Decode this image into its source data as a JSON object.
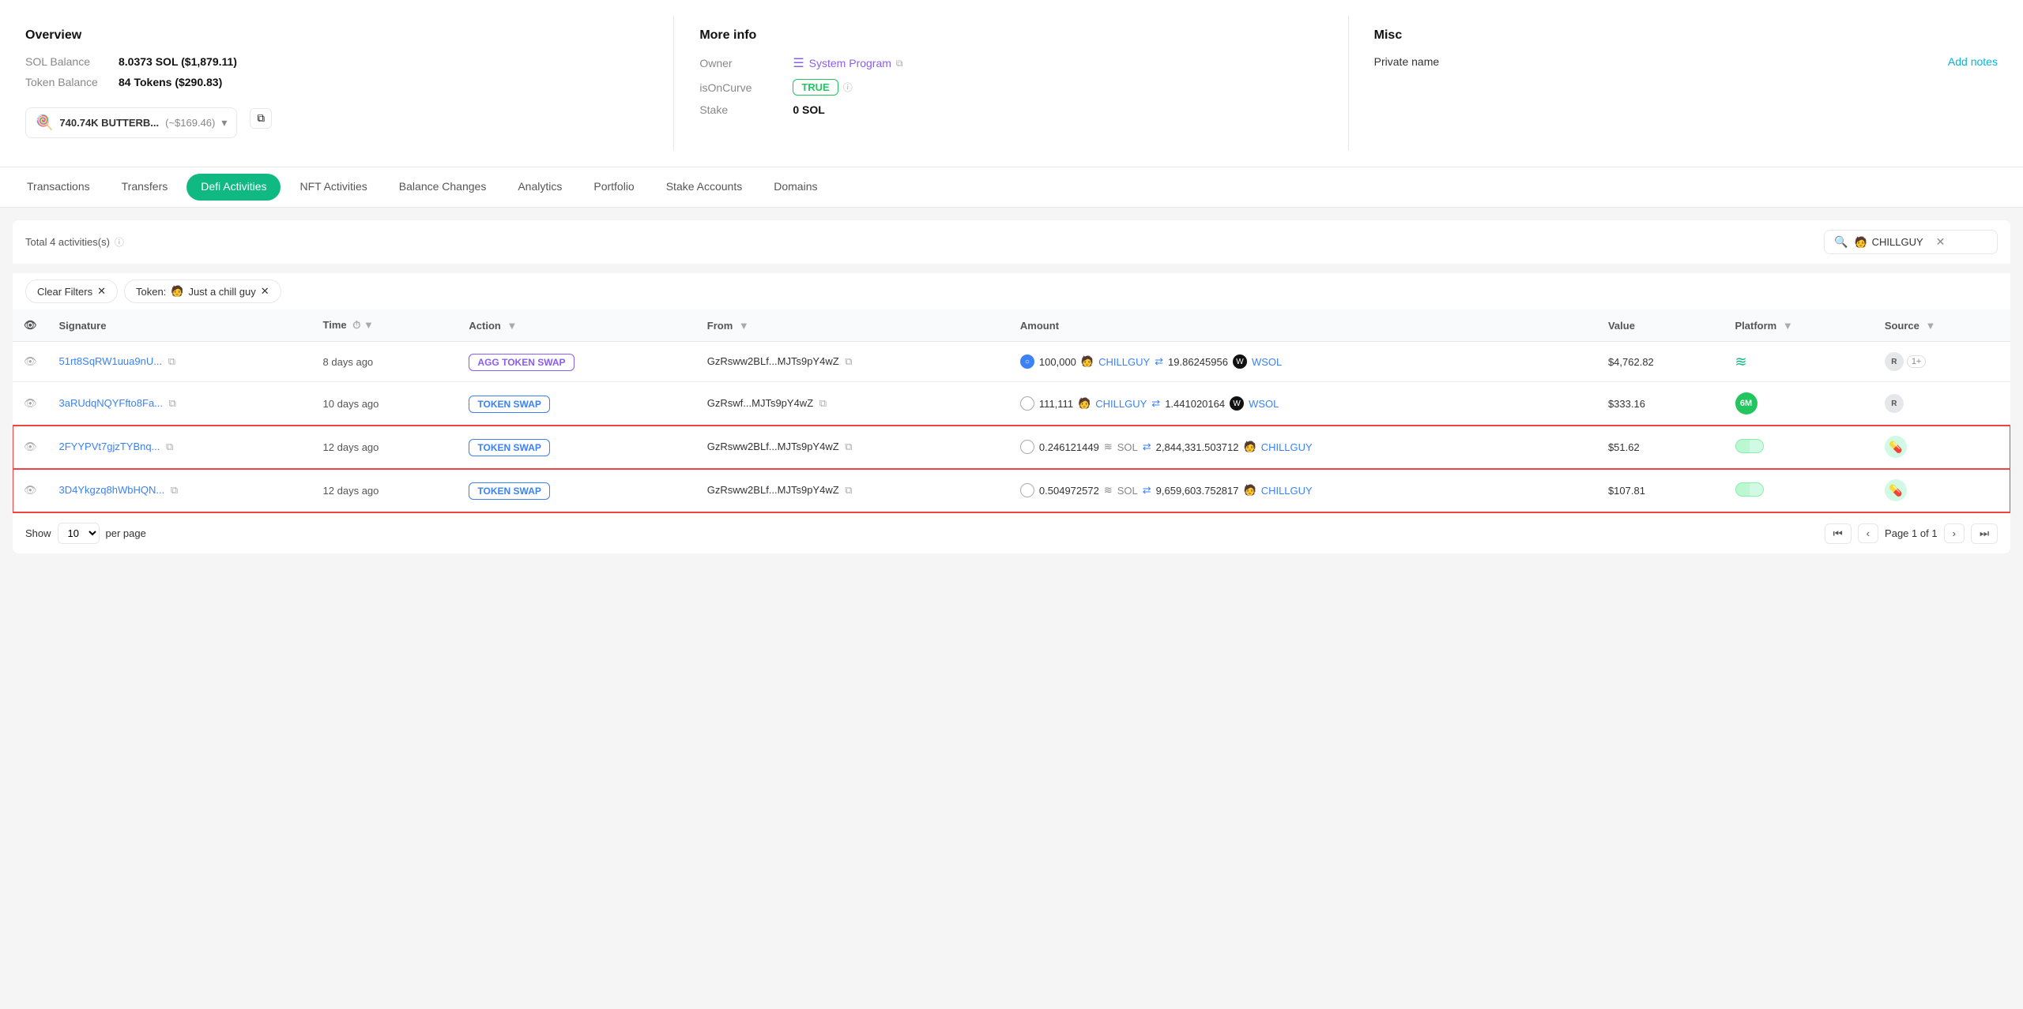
{
  "overview": {
    "title": "Overview",
    "sol_balance_label": "SOL Balance",
    "sol_balance_value": "8.0373 SOL ($1,879.11)",
    "token_balance_label": "Token Balance",
    "token_balance_value": "84 Tokens ($290.83)",
    "selected_token_emoji": "🍭",
    "selected_token_name": "740.74K BUTTERB...",
    "selected_token_usd": "(~$169.46)"
  },
  "more_info": {
    "title": "More info",
    "owner_label": "Owner",
    "owner_value": "System Program",
    "isoncurve_label": "isOnCurve",
    "isoncurve_value": "TRUE",
    "stake_label": "Stake",
    "stake_value": "0 SOL"
  },
  "misc": {
    "title": "Misc",
    "private_name_label": "Private name",
    "add_notes_label": "Add notes"
  },
  "tabs": [
    {
      "id": "transactions",
      "label": "Transactions"
    },
    {
      "id": "transfers",
      "label": "Transfers"
    },
    {
      "id": "defi",
      "label": "Defi Activities",
      "active": true
    },
    {
      "id": "nft",
      "label": "NFT Activities"
    },
    {
      "id": "balance_changes",
      "label": "Balance Changes"
    },
    {
      "id": "analytics",
      "label": "Analytics"
    },
    {
      "id": "portfolio",
      "label": "Portfolio"
    },
    {
      "id": "stake_accounts",
      "label": "Stake Accounts"
    },
    {
      "id": "domains",
      "label": "Domains"
    }
  ],
  "table": {
    "total_label": "Total 4 activities(s)",
    "search_value": "CHILLGUY",
    "clear_filters_label": "Clear Filters",
    "token_filter_label": "Token:",
    "token_filter_name": "Just a chill guy",
    "columns": {
      "visibility": "",
      "signature": "Signature",
      "time": "Time",
      "action": "Action",
      "from": "From",
      "amount": "Amount",
      "value": "Value",
      "platform": "Platform",
      "source": "Source"
    },
    "rows": [
      {
        "id": "row1",
        "highlighted": false,
        "signature": "51rt8SqRW1uua9nU...",
        "time": "8 days ago",
        "action": "AGG TOKEN SWAP",
        "action_type": "agg",
        "from": "GzRsww2BLf...MJTs9pY4wZ",
        "amount_in_num": "100,000",
        "amount_in_token": "CHILLGUY",
        "amount_out_num": "19.86245956",
        "amount_out_token": "WSOL",
        "value": "$4,762.82",
        "platform": "wifi",
        "source_type": "multi",
        "source_r": true,
        "source_plus": "1+"
      },
      {
        "id": "row2",
        "highlighted": false,
        "signature": "3aRUdqNQYFfto8Fa...",
        "time": "10 days ago",
        "action": "TOKEN SWAP",
        "action_type": "normal",
        "from": "GzRswf...MJTs9pY4wZ",
        "amount_in_num": "111,111",
        "amount_in_token": "CHILLGUY",
        "amount_out_num": "1.441020164",
        "amount_out_token": "WSOL",
        "value": "$333.16",
        "platform": "6M",
        "source_type": "r",
        "source_r": true,
        "source_plus": ""
      },
      {
        "id": "row3",
        "highlighted": true,
        "signature": "2FYYPVt7gjzTYBnq...",
        "time": "12 days ago",
        "action": "TOKEN SWAP",
        "action_type": "normal",
        "from": "GzRsww2BLf...MJTs9pY4wZ",
        "amount_in_num": "0.246121449",
        "amount_in_token": "SOL",
        "amount_out_num": "2,844,331.503712",
        "amount_out_token": "CHILLGUY",
        "value": "$51.62",
        "platform": "capsule",
        "source_type": "capsule",
        "source_r": false,
        "source_plus": ""
      },
      {
        "id": "row4",
        "highlighted": true,
        "signature": "3D4Ykgzq8hWbHQN...",
        "time": "12 days ago",
        "action": "TOKEN SWAP",
        "action_type": "normal",
        "from": "GzRsww2BLf...MJTs9pY4wZ",
        "amount_in_num": "0.504972572",
        "amount_in_token": "SOL",
        "amount_out_num": "9,659,603.752817",
        "amount_out_token": "CHILLGUY",
        "value": "$107.81",
        "platform": "capsule",
        "source_type": "capsule",
        "source_r": false,
        "source_plus": ""
      }
    ],
    "pagination": {
      "show_label": "Show",
      "per_page_label": "per page",
      "page_text": "Page 1 of 1",
      "per_page_value": "10"
    }
  }
}
